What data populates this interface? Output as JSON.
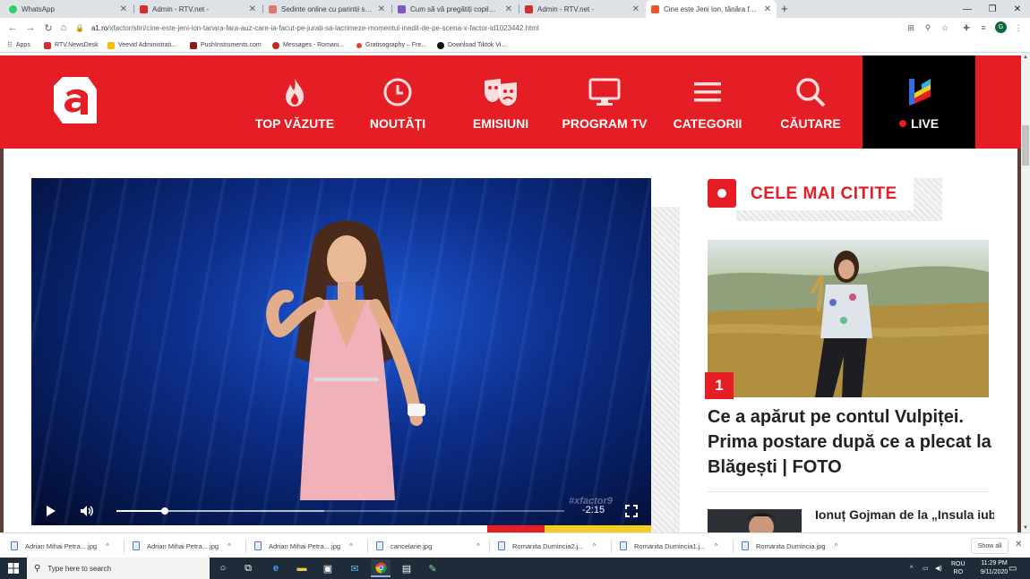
{
  "browser": {
    "tabs": [
      {
        "title": "WhatsApp",
        "color": "#25d366"
      },
      {
        "title": "Admin - RTV.net -",
        "color": "#d32f2f"
      },
      {
        "title": "Sedinte online cu parintii si atrib",
        "color": "#e57373"
      },
      {
        "title": "Cum să vă pregătiți copilul pentr",
        "color": "#7e57c2"
      },
      {
        "title": "Admin - RTV.net -",
        "color": "#d32f2f"
      },
      {
        "title": "Cine este Jeni Ion, tânăra fără au",
        "color": "#e8572b"
      }
    ],
    "active_tab": 5,
    "url_host": "a1.ro",
    "url_path": "/xfactor/stiri/cine-este-jeni-ion-tanara-fara-auz-care-ia-facut-pe-jurati-sa-lacrimeze-momentul-inedit-de-pe-scena-x-factor-id1023442.html",
    "profile_initial": "G",
    "bookmarks": [
      {
        "label": "Apps",
        "color": "#5f6368"
      },
      {
        "label": "RTV.NewsDesk",
        "color": "#d32f2f"
      },
      {
        "label": "Veevid Administrati...",
        "color": "#fbbc04"
      },
      {
        "label": "PushInstruments.com",
        "color": "#8b1a1a"
      },
      {
        "label": "Messages - Romani...",
        "color": "#c62828"
      },
      {
        "label": "Gratisography – Fre...",
        "color": "#e53935"
      },
      {
        "label": "Download Tiktok Vi...",
        "color": "#111111"
      }
    ]
  },
  "site": {
    "brand_color": "#e41e24",
    "menu": [
      {
        "label": "TOP VĂZUTE",
        "icon": "flame-icon"
      },
      {
        "label": "NOUTĂȚI",
        "icon": "clock-icon"
      },
      {
        "label": "EMISIUNI",
        "icon": "theater-masks-icon"
      },
      {
        "label": "PROGRAM TV",
        "icon": "monitor-icon"
      },
      {
        "label": "CATEGORII",
        "icon": "hamburger-menu-icon"
      },
      {
        "label": "CĂUTARE",
        "icon": "search-icon"
      }
    ],
    "live_label": "LIVE"
  },
  "video": {
    "time_remaining": "-2:15",
    "watermark": "#xfactor9",
    "progress": 0.108,
    "buffered": 0.464
  },
  "sidebar": {
    "title": "CELE MAI CITITE",
    "articles": [
      {
        "rank": "1",
        "headline": "Ce a apărut pe contul Vulpiței. Prima postare după ce a plecat la Blăgești | FOTO"
      },
      {
        "headline": "Ionuț Gojman de la „Insula iubirii”, de"
      }
    ]
  },
  "downloads": {
    "items": [
      "Adrian Mihai Petra....jpg",
      "Adrian Mihai Petra....jpg",
      "Adrian Mihai Petra....jpg",
      "cancelarie.jpg",
      "Romanita Dumincia2.j...",
      "Romanita Dumincia1.j...",
      "Romanita Dumincia.jpg"
    ],
    "show_all": "Show all"
  },
  "taskbar": {
    "search_placeholder": "Type here to search",
    "language": "ROU",
    "language_sub": "RO",
    "time": "11:29 PM",
    "date": "9/11/2020"
  }
}
